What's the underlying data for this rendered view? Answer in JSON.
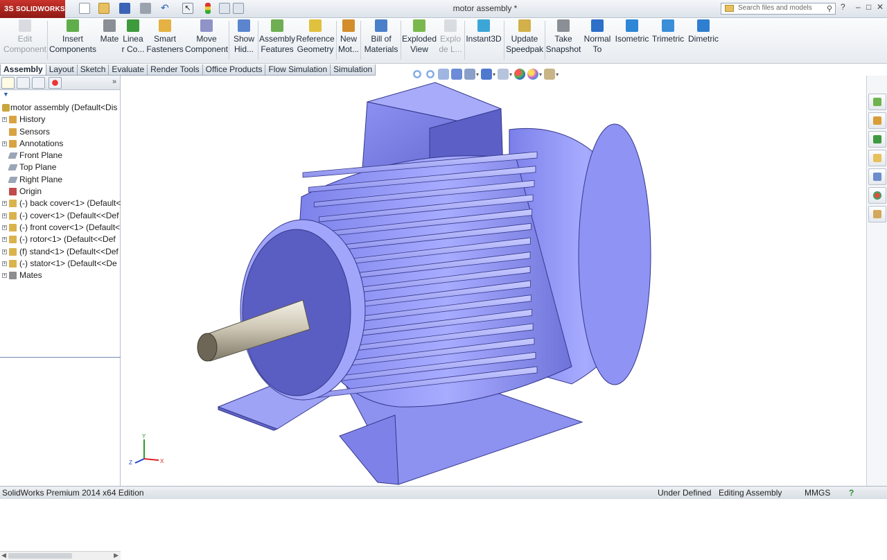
{
  "app": {
    "logo_text": "SOLIDWORKS",
    "document_title": "motor assembly *",
    "search_placeholder": "Search files and models",
    "help_icon": "?",
    "window_controls": [
      "–",
      "□",
      "✕"
    ]
  },
  "commands": [
    {
      "label": "Edit\nComponent",
      "icon": "edit-component-icon",
      "disabled": true
    },
    {
      "label": "Insert\nComponents",
      "icon": "insert-components-icon"
    },
    {
      "label": "Mate",
      "icon": "mate-icon"
    },
    {
      "label": "Linea\nr Co...",
      "icon": "linear-pattern-icon"
    },
    {
      "label": "Smart\nFasteners",
      "icon": "smart-fasteners-icon"
    },
    {
      "label": "Move\nComponent",
      "icon": "move-component-icon"
    },
    {
      "label": "Show\nHid...",
      "icon": "show-hidden-icon"
    },
    {
      "label": "Assembly\nFeatures",
      "icon": "assembly-features-icon"
    },
    {
      "label": "Reference\nGeometry",
      "icon": "reference-geometry-icon"
    },
    {
      "label": "New\nMot...",
      "icon": "new-motion-study-icon"
    },
    {
      "label": "Bill of\nMaterials",
      "icon": "bill-of-materials-icon"
    },
    {
      "label": "Exploded\nView",
      "icon": "exploded-view-icon"
    },
    {
      "label": "Explo\nde L...",
      "icon": "explode-line-icon",
      "disabled": true
    },
    {
      "label": "Instant3D",
      "icon": "instant3d-icon"
    },
    {
      "label": "Update\nSpeedpak",
      "icon": "update-speedpak-icon"
    },
    {
      "label": "Take\nSnapshot",
      "icon": "take-snapshot-icon"
    },
    {
      "label": "Normal\nTo",
      "icon": "normal-to-icon"
    },
    {
      "label": "Isometric",
      "icon": "isometric-icon"
    },
    {
      "label": "Trimetric",
      "icon": "trimetric-icon"
    },
    {
      "label": "Dimetric",
      "icon": "dimetric-icon"
    }
  ],
  "tabs": [
    {
      "label": "Assembly",
      "active": true
    },
    {
      "label": "Layout"
    },
    {
      "label": "Sketch"
    },
    {
      "label": "Evaluate"
    },
    {
      "label": "Render Tools"
    },
    {
      "label": "Office Products"
    },
    {
      "label": "Flow Simulation"
    },
    {
      "label": "Simulation"
    }
  ],
  "tree": {
    "root": "motor assembly  (Default<Dis",
    "items": [
      {
        "label": "History",
        "expander": "+",
        "icon": "history-icon"
      },
      {
        "label": "Sensors",
        "expander": "",
        "icon": "sensors-icon"
      },
      {
        "label": "Annotations",
        "expander": "+",
        "icon": "annotations-icon"
      },
      {
        "label": "Front Plane",
        "expander": "",
        "icon": "plane-icon"
      },
      {
        "label": "Top Plane",
        "expander": "",
        "icon": "plane-icon"
      },
      {
        "label": "Right Plane",
        "expander": "",
        "icon": "plane-icon"
      },
      {
        "label": "Origin",
        "expander": "",
        "icon": "origin-icon"
      },
      {
        "label": "(-) back cover<1> (Default<",
        "expander": "+",
        "icon": "part-icon"
      },
      {
        "label": "(-) cover<1> (Default<<Def",
        "expander": "+",
        "icon": "part-icon"
      },
      {
        "label": "(-) front cover<1> (Default<",
        "expander": "+",
        "icon": "part-icon"
      },
      {
        "label": "(-) rotor<1> (Default<<Def",
        "expander": "+",
        "icon": "part-icon"
      },
      {
        "label": "(f) stand<1> (Default<<Def",
        "expander": "+",
        "icon": "part-icon"
      },
      {
        "label": "(-) stator<1> (Default<<De",
        "expander": "+",
        "icon": "part-icon"
      },
      {
        "label": "Mates",
        "expander": "+",
        "icon": "mates-icon"
      }
    ]
  },
  "triad": {
    "x": "X",
    "y": "Y",
    "z": "Z"
  },
  "status": {
    "edition": "SolidWorks Premium 2014 x64 Edition",
    "state": "Under Defined",
    "mode": "Editing Assembly",
    "units": "MMGS",
    "help": "?"
  },
  "colors": {
    "model_face": "#8b8ff0",
    "model_light": "#c6c9ff",
    "model_dark": "#3a3d9c",
    "shaft": "#bdb6a6",
    "brand_red": "#c9342c"
  }
}
